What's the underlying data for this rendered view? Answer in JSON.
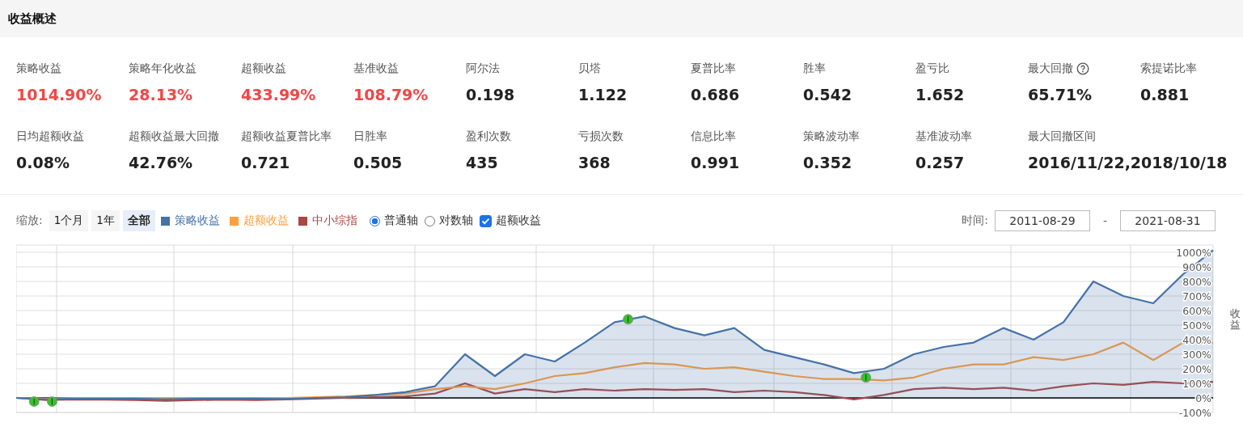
{
  "header": {
    "title": "收益概述"
  },
  "metrics": [
    {
      "label": "策略收益",
      "value": "1014.90%",
      "color": "#f04848",
      "info_icon": false
    },
    {
      "label": "策略年化收益",
      "value": "28.13%",
      "color": "#f04848",
      "info_icon": false
    },
    {
      "label": "超额收益",
      "value": "433.99%",
      "color": "#f04848",
      "info_icon": false
    },
    {
      "label": "基准收益",
      "value": "108.79%",
      "color": "#f04848",
      "info_icon": false
    },
    {
      "label": "阿尔法",
      "value": "0.198",
      "color": "#222222",
      "info_icon": false
    },
    {
      "label": "贝塔",
      "value": "1.122",
      "color": "#222222",
      "info_icon": false
    },
    {
      "label": "夏普比率",
      "value": "0.686",
      "color": "#222222",
      "info_icon": false
    },
    {
      "label": "胜率",
      "value": "0.542",
      "color": "#222222",
      "info_icon": false
    },
    {
      "label": "盈亏比",
      "value": "1.652",
      "color": "#222222",
      "info_icon": false
    },
    {
      "label": "最大回撤",
      "value": "65.71%",
      "color": "#222222",
      "info_icon": true
    },
    {
      "label": "索提诺比率",
      "value": "0.881",
      "color": "#222222",
      "info_icon": false
    },
    {
      "label": "日均超额收益",
      "value": "0.08%",
      "color": "#222222",
      "info_icon": false
    },
    {
      "label": "超额收益最大回撤",
      "value": "42.76%",
      "color": "#222222",
      "info_icon": false
    },
    {
      "label": "超额收益夏普比率",
      "value": "0.721",
      "color": "#222222",
      "info_icon": false
    },
    {
      "label": "日胜率",
      "value": "0.505",
      "color": "#222222",
      "info_icon": false
    },
    {
      "label": "盈利次数",
      "value": "435",
      "color": "#222222",
      "info_icon": false
    },
    {
      "label": "亏损次数",
      "value": "368",
      "color": "#222222",
      "info_icon": false
    },
    {
      "label": "信息比率",
      "value": "0.991",
      "color": "#222222",
      "info_icon": false
    },
    {
      "label": "策略波动率",
      "value": "0.352",
      "color": "#222222",
      "info_icon": false
    },
    {
      "label": "基准波动率",
      "value": "0.257",
      "color": "#222222",
      "info_icon": false
    },
    {
      "label": "最大回撤区间",
      "value": "2016/11/22,2018/10/18",
      "color": "#222222",
      "info_icon": false
    }
  ],
  "toolbar": {
    "zoom_label": "缩放:",
    "zoom_buttons": [
      {
        "label": "1个月",
        "selected": false
      },
      {
        "label": "1年",
        "selected": false
      },
      {
        "label": "全部",
        "selected": true
      }
    ],
    "axis_options": [
      {
        "label": "普通轴",
        "selected": true
      },
      {
        "label": "对数轴",
        "selected": false
      }
    ],
    "excess_toggle": {
      "label": "超额收益",
      "checked": true
    },
    "time_label": "时间:",
    "start_date": "2011-08-29",
    "separator": "-",
    "end_date": "2021-08-31"
  },
  "chart": {
    "chart_data": {
      "type": "line",
      "grid": true,
      "ylabel": "收益",
      "ylim": [
        -100,
        1050
      ],
      "yticks": [
        {
          "value": -100,
          "label": "-100%"
        },
        {
          "value": 0,
          "label": "0%"
        },
        {
          "value": 100,
          "label": "100%"
        },
        {
          "value": 200,
          "label": "200%"
        },
        {
          "value": 300,
          "label": "300%"
        },
        {
          "value": 400,
          "label": "400%"
        },
        {
          "value": 500,
          "label": "500%"
        },
        {
          "value": 600,
          "label": "600%"
        },
        {
          "value": 700,
          "label": "700%"
        },
        {
          "value": 800,
          "label": "800%"
        },
        {
          "value": 900,
          "label": "900%"
        },
        {
          "value": 1000,
          "label": "1000%"
        }
      ],
      "series": [
        {
          "name": "策略收益",
          "color": "#4572a7",
          "values": [
            0,
            -10,
            -5,
            -5,
            -5,
            -10,
            -5,
            -5,
            -5,
            -8,
            0,
            5,
            20,
            40,
            80,
            300,
            150,
            300,
            250,
            380,
            520,
            560,
            480,
            430,
            480,
            330,
            280,
            230,
            170,
            200,
            300,
            350,
            380,
            480,
            400,
            520,
            800,
            700,
            650,
            850,
            1015
          ]
        },
        {
          "name": "超额收益",
          "color": "#ff9f3f",
          "values": [
            0,
            -5,
            0,
            0,
            0,
            0,
            0,
            0,
            0,
            0,
            5,
            10,
            20,
            30,
            60,
            80,
            60,
            100,
            150,
            170,
            210,
            240,
            230,
            200,
            210,
            180,
            150,
            130,
            130,
            120,
            140,
            200,
            230,
            230,
            280,
            260,
            300,
            380,
            260,
            380,
            380
          ]
        },
        {
          "name": "中小综指",
          "color": "#aa4643",
          "values": [
            0,
            -15,
            -10,
            -12,
            -15,
            -20,
            -15,
            -12,
            -15,
            -10,
            -5,
            0,
            5,
            10,
            30,
            100,
            30,
            60,
            40,
            60,
            50,
            60,
            55,
            60,
            40,
            50,
            40,
            20,
            -10,
            20,
            60,
            70,
            60,
            70,
            50,
            80,
            100,
            90,
            110,
            100,
            110
          ]
        }
      ]
    }
  }
}
